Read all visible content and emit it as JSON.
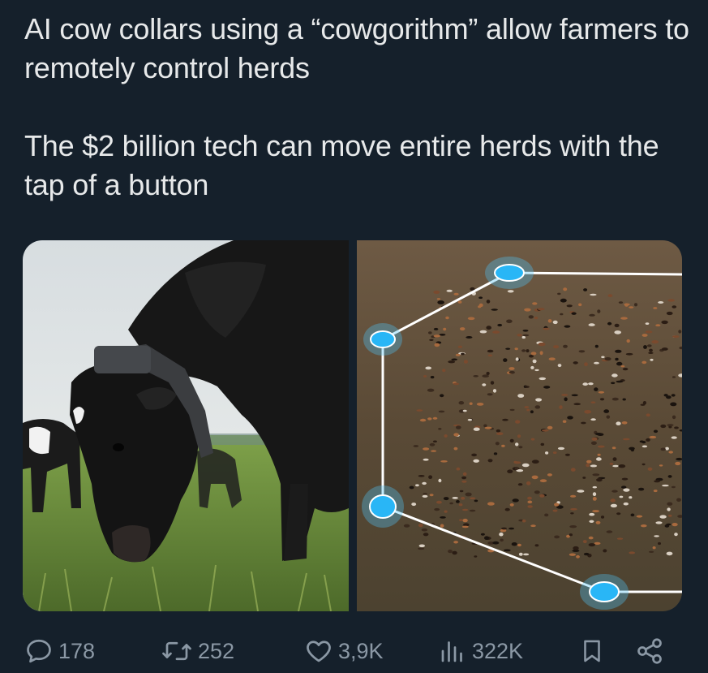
{
  "tweet": {
    "paragraphs": [
      "AI cow collars using a “cowgorithm” allow farmers to remotely control herds",
      "The $2 billion tech can move entire herds with the tap of a button"
    ]
  },
  "media": {
    "left_photo": "cow-with-collar-grazing",
    "right_photo": "aerial-herd-with-virtual-fence"
  },
  "actions": {
    "replies": "178",
    "retweets": "252",
    "likes": "3,9K",
    "views": "322K"
  },
  "colors": {
    "background": "#15202b",
    "text": "#e7e9ea",
    "muted": "#8b98a5",
    "fence_node": "#1da1f2"
  },
  "icons": [
    "reply-icon",
    "retweet-icon",
    "like-icon",
    "views-icon",
    "bookmark-icon",
    "share-icon"
  ]
}
